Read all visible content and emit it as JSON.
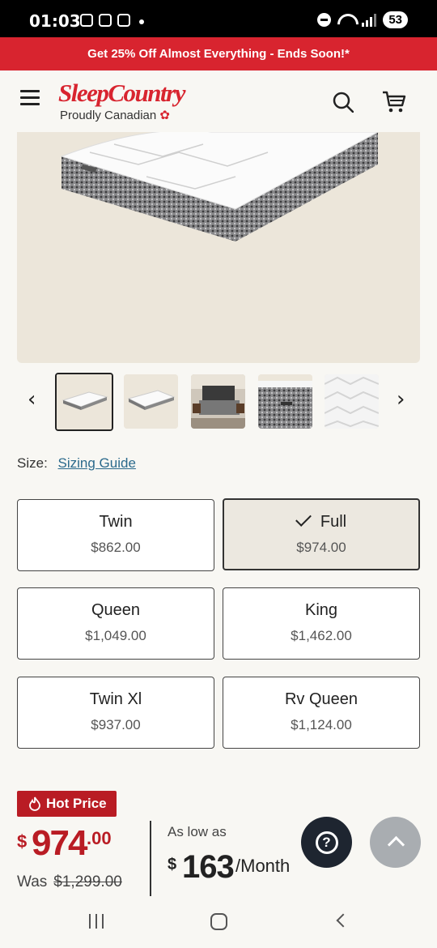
{
  "status_bar": {
    "time": "01:03",
    "battery": "53"
  },
  "promo_banner": "Get 25% Off Almost Everything - Ends Soon!*",
  "header": {
    "brand": "SleepCountry",
    "tagline": "Proudly Canadian",
    "brand_color": "#d8242f"
  },
  "gallery": {
    "thumbnail_count": 5,
    "active_index": 0
  },
  "size_selector": {
    "label": "Size:",
    "guide_link": "Sizing Guide",
    "options": [
      {
        "name": "Twin",
        "price": "$862.00",
        "selected": false
      },
      {
        "name": "Full",
        "price": "$974.00",
        "selected": true
      },
      {
        "name": "Queen",
        "price": "$1,049.00",
        "selected": false
      },
      {
        "name": "King",
        "price": "$1,462.00",
        "selected": false
      },
      {
        "name": "Twin Xl",
        "price": "$937.00",
        "selected": false
      },
      {
        "name": "Rv Queen",
        "price": "$1,124.00",
        "selected": false
      }
    ]
  },
  "pricing": {
    "badge": "Hot Price",
    "currency": "$",
    "whole": "974",
    "cents": ".00",
    "was_label": "Was",
    "was_price": "$1,299.00",
    "financing_label": "As low as",
    "monthly_amount": "163",
    "monthly_suffix": "/Month",
    "accent_color": "#b91c24"
  },
  "floating": {
    "help_icon": "question-mark-icon",
    "top_icon": "chevron-up-icon"
  }
}
